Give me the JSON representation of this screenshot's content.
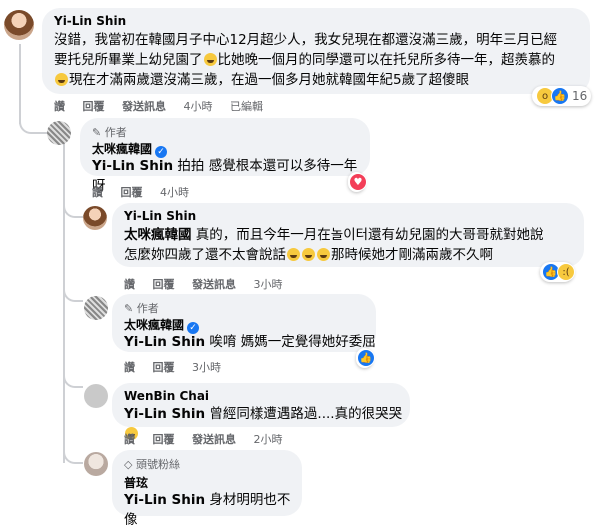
{
  "c1": {
    "name": "Yi-Lin Shin",
    "line1": "沒錯，我當初在韓國月子中心12月超少人，我女兒現在都還沒滿三歲，明年三月已經",
    "line2a": "要托兒所畢業上幼兒園了",
    "line2b": "比她晚一個月的同學還可以在托兒所多待一年，超羨慕的",
    "line3": "現在才滿兩歲還沒滿三歲，在過一個多月她就韓國年紀5歲了超傻眼",
    "actions": [
      "讚",
      "回覆",
      "發送訊息",
      "4小時",
      "已編輯"
    ],
    "reactions_count": "16"
  },
  "c2": {
    "author_tag": "作者",
    "name": "太咪瘋韓國",
    "mention": "Yi-Lin Shin",
    "text": "拍拍 感覺根本還可以多待一年呀",
    "actions": [
      "讚",
      "回覆",
      "4小時"
    ]
  },
  "c3": {
    "name": "Yi-Lin Shin",
    "mention": "太咪瘋韓國",
    "line1": "真的，而且今年一月在놀이터還有幼兒園的大哥哥就對她說",
    "line2a": "怎麼妳四歲了還不太會說話",
    "line2b": "那時候她才剛滿兩歲不久啊",
    "actions": [
      "讚",
      "回覆",
      "發送訊息",
      "3小時"
    ]
  },
  "c4": {
    "author_tag": "作者",
    "name": "太咪瘋韓國",
    "mention": "Yi-Lin Shin",
    "text": "唉唷 媽媽一定覺得她好委屈",
    "actions": [
      "讚",
      "回覆",
      "3小時"
    ]
  },
  "c5": {
    "name": "WenBin Chai",
    "mention": "Yi-Lin Shin",
    "text": "曾經同樣遭遇路過....真的很哭哭",
    "actions": [
      "讚",
      "回覆",
      "發送訊息",
      "2小時"
    ]
  },
  "c6": {
    "badge": "頭號粉絲",
    "name": "普玹",
    "mention": "Yi-Lin Shin",
    "text": "身材明明也不像"
  }
}
